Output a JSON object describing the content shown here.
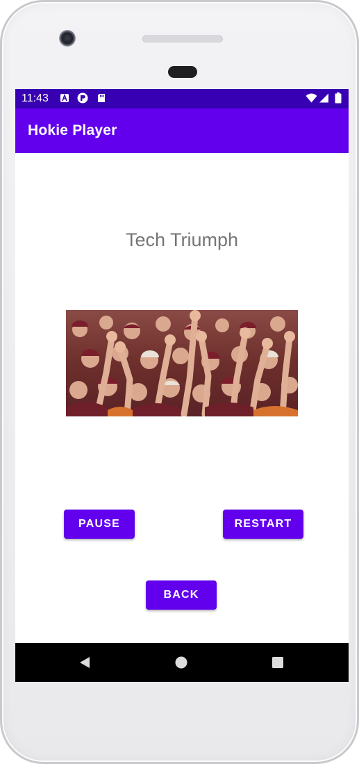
{
  "status_bar": {
    "time": "11:43",
    "left_icons": [
      "a-notification-icon",
      "p-notification-icon",
      "sd-card-icon"
    ],
    "right_icons": [
      "wifi-icon",
      "cellular-signal-icon",
      "battery-icon"
    ],
    "color": "#3700b3"
  },
  "app_bar": {
    "title": "Hokie Player",
    "color": "#6200ee"
  },
  "player": {
    "song_title": "Tech Triumph",
    "image_description_icon": "crowd-cheering-photo"
  },
  "buttons": {
    "pause": "PAUSE",
    "restart": "RESTART",
    "back": "BACK",
    "color": "#6200ee"
  },
  "nav_bar": {
    "icons": [
      "back-triangle-icon",
      "home-circle-icon",
      "recents-square-icon"
    ]
  }
}
